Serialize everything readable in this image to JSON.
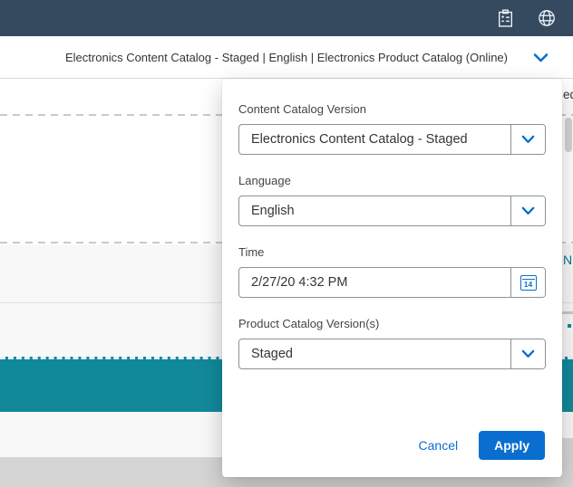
{
  "colors": {
    "shellbar": "#354a5f",
    "accent_blue": "#0a6ed1",
    "teal_band": "#12899b",
    "footer_gray": "#d5d5d5",
    "light_gray": "#f8f8f8",
    "input_border": "#89919a",
    "label_text": "#42454a",
    "value_text": "#32363a"
  },
  "shellbar": {
    "icons": [
      "tasks-clipboard-icon",
      "globe-icon"
    ]
  },
  "toolbar": {
    "selector_text": "Electronics Content Catalog - Staged | English | Electronics Product Catalog (Online)",
    "icon": "chevron-down-icon"
  },
  "panel": {
    "fields": [
      {
        "label": "Content Catalog Version",
        "value": "Electronics Content Catalog - Staged",
        "type": "select"
      },
      {
        "label": "Language",
        "value": "English",
        "type": "select"
      },
      {
        "label": "Time",
        "value": "2/27/20 4:32 PM",
        "type": "datetime"
      },
      {
        "label": "Product Catalog Version(s)",
        "value": "Staged",
        "type": "select"
      }
    ],
    "calendar_day": "14",
    "cancel_label": "Cancel",
    "apply_label": "Apply"
  },
  "background": {
    "clipped_text_top_right": "ed",
    "clipped_text_mid_right": "N"
  }
}
